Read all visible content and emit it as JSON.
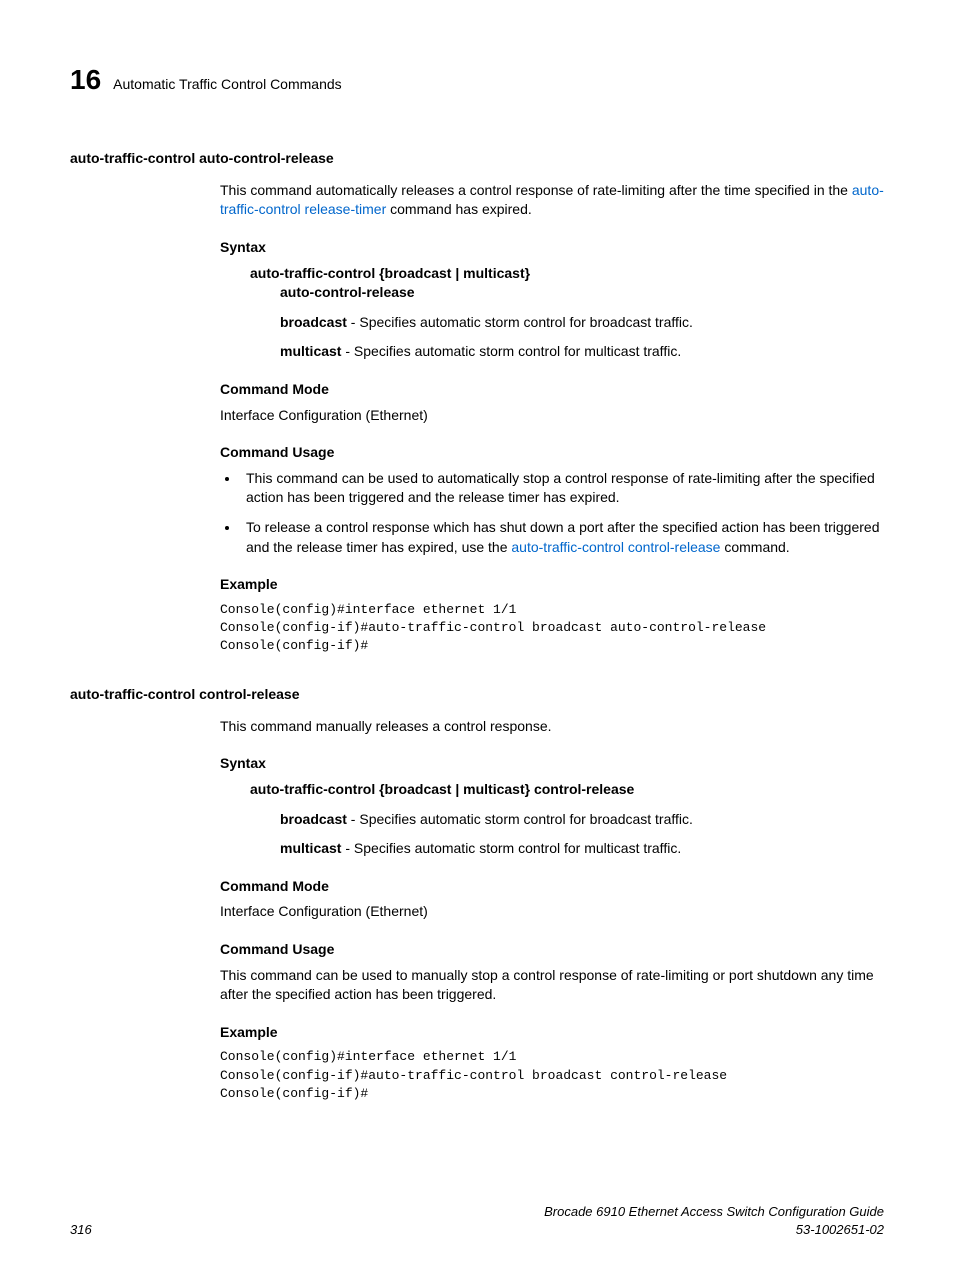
{
  "header": {
    "chapter": "16",
    "title": "Automatic Traffic Control Commands"
  },
  "sec1": {
    "title": "auto-traffic-control auto-control-release",
    "desc_a": "This command automatically releases a control response of rate-limiting after the time specified in the ",
    "desc_link": "auto-traffic-control release-timer",
    "desc_b": " command has expired.",
    "syntax_h": "Syntax",
    "syntax_l1": "auto-traffic-control {broadcast | multicast}",
    "syntax_l2": "auto-control-release",
    "p1_name": "broadcast",
    "p1_desc": " - Specifies automatic storm control for broadcast traffic.",
    "p2_name": "multicast",
    "p2_desc": " - Specifies automatic storm control for multicast traffic.",
    "mode_h": "Command Mode",
    "mode_t": "Interface Configuration (Ethernet)",
    "usage_h": "Command Usage",
    "usage_li1": "This command can be used to automatically stop a control response of rate-limiting after the specified action has been triggered and the release timer has expired.",
    "usage_li2_a": "To release a control response which has shut down a port after the specified action has been triggered and the release timer has expired, use the ",
    "usage_li2_link": "auto-traffic-control control-release",
    "usage_li2_b": " command.",
    "example_h": "Example",
    "example_code": "Console(config)#interface ethernet 1/1\nConsole(config-if)#auto-traffic-control broadcast auto-control-release\nConsole(config-if)#"
  },
  "sec2": {
    "title": "auto-traffic-control control-release",
    "desc": "This command manually releases a control response.",
    "syntax_h": "Syntax",
    "syntax_l1": "auto-traffic-control {broadcast | multicast} control-release",
    "p1_name": "broadcast",
    "p1_desc": " - Specifies automatic storm control for broadcast traffic.",
    "p2_name": "multicast",
    "p2_desc": " - Specifies automatic storm control for multicast traffic.",
    "mode_h": "Command Mode",
    "mode_t": "Interface Configuration (Ethernet)",
    "usage_h": "Command Usage",
    "usage_t": "This command can be used to manually stop a control response of rate-limiting or port shutdown any time after the specified action has been triggered.",
    "example_h": "Example",
    "example_code": "Console(config)#interface ethernet 1/1\nConsole(config-if)#auto-traffic-control broadcast control-release\nConsole(config-if)#"
  },
  "footer": {
    "page": "316",
    "doc": "Brocade 6910 Ethernet Access Switch Configuration Guide",
    "docnum": "53-1002651-02"
  }
}
